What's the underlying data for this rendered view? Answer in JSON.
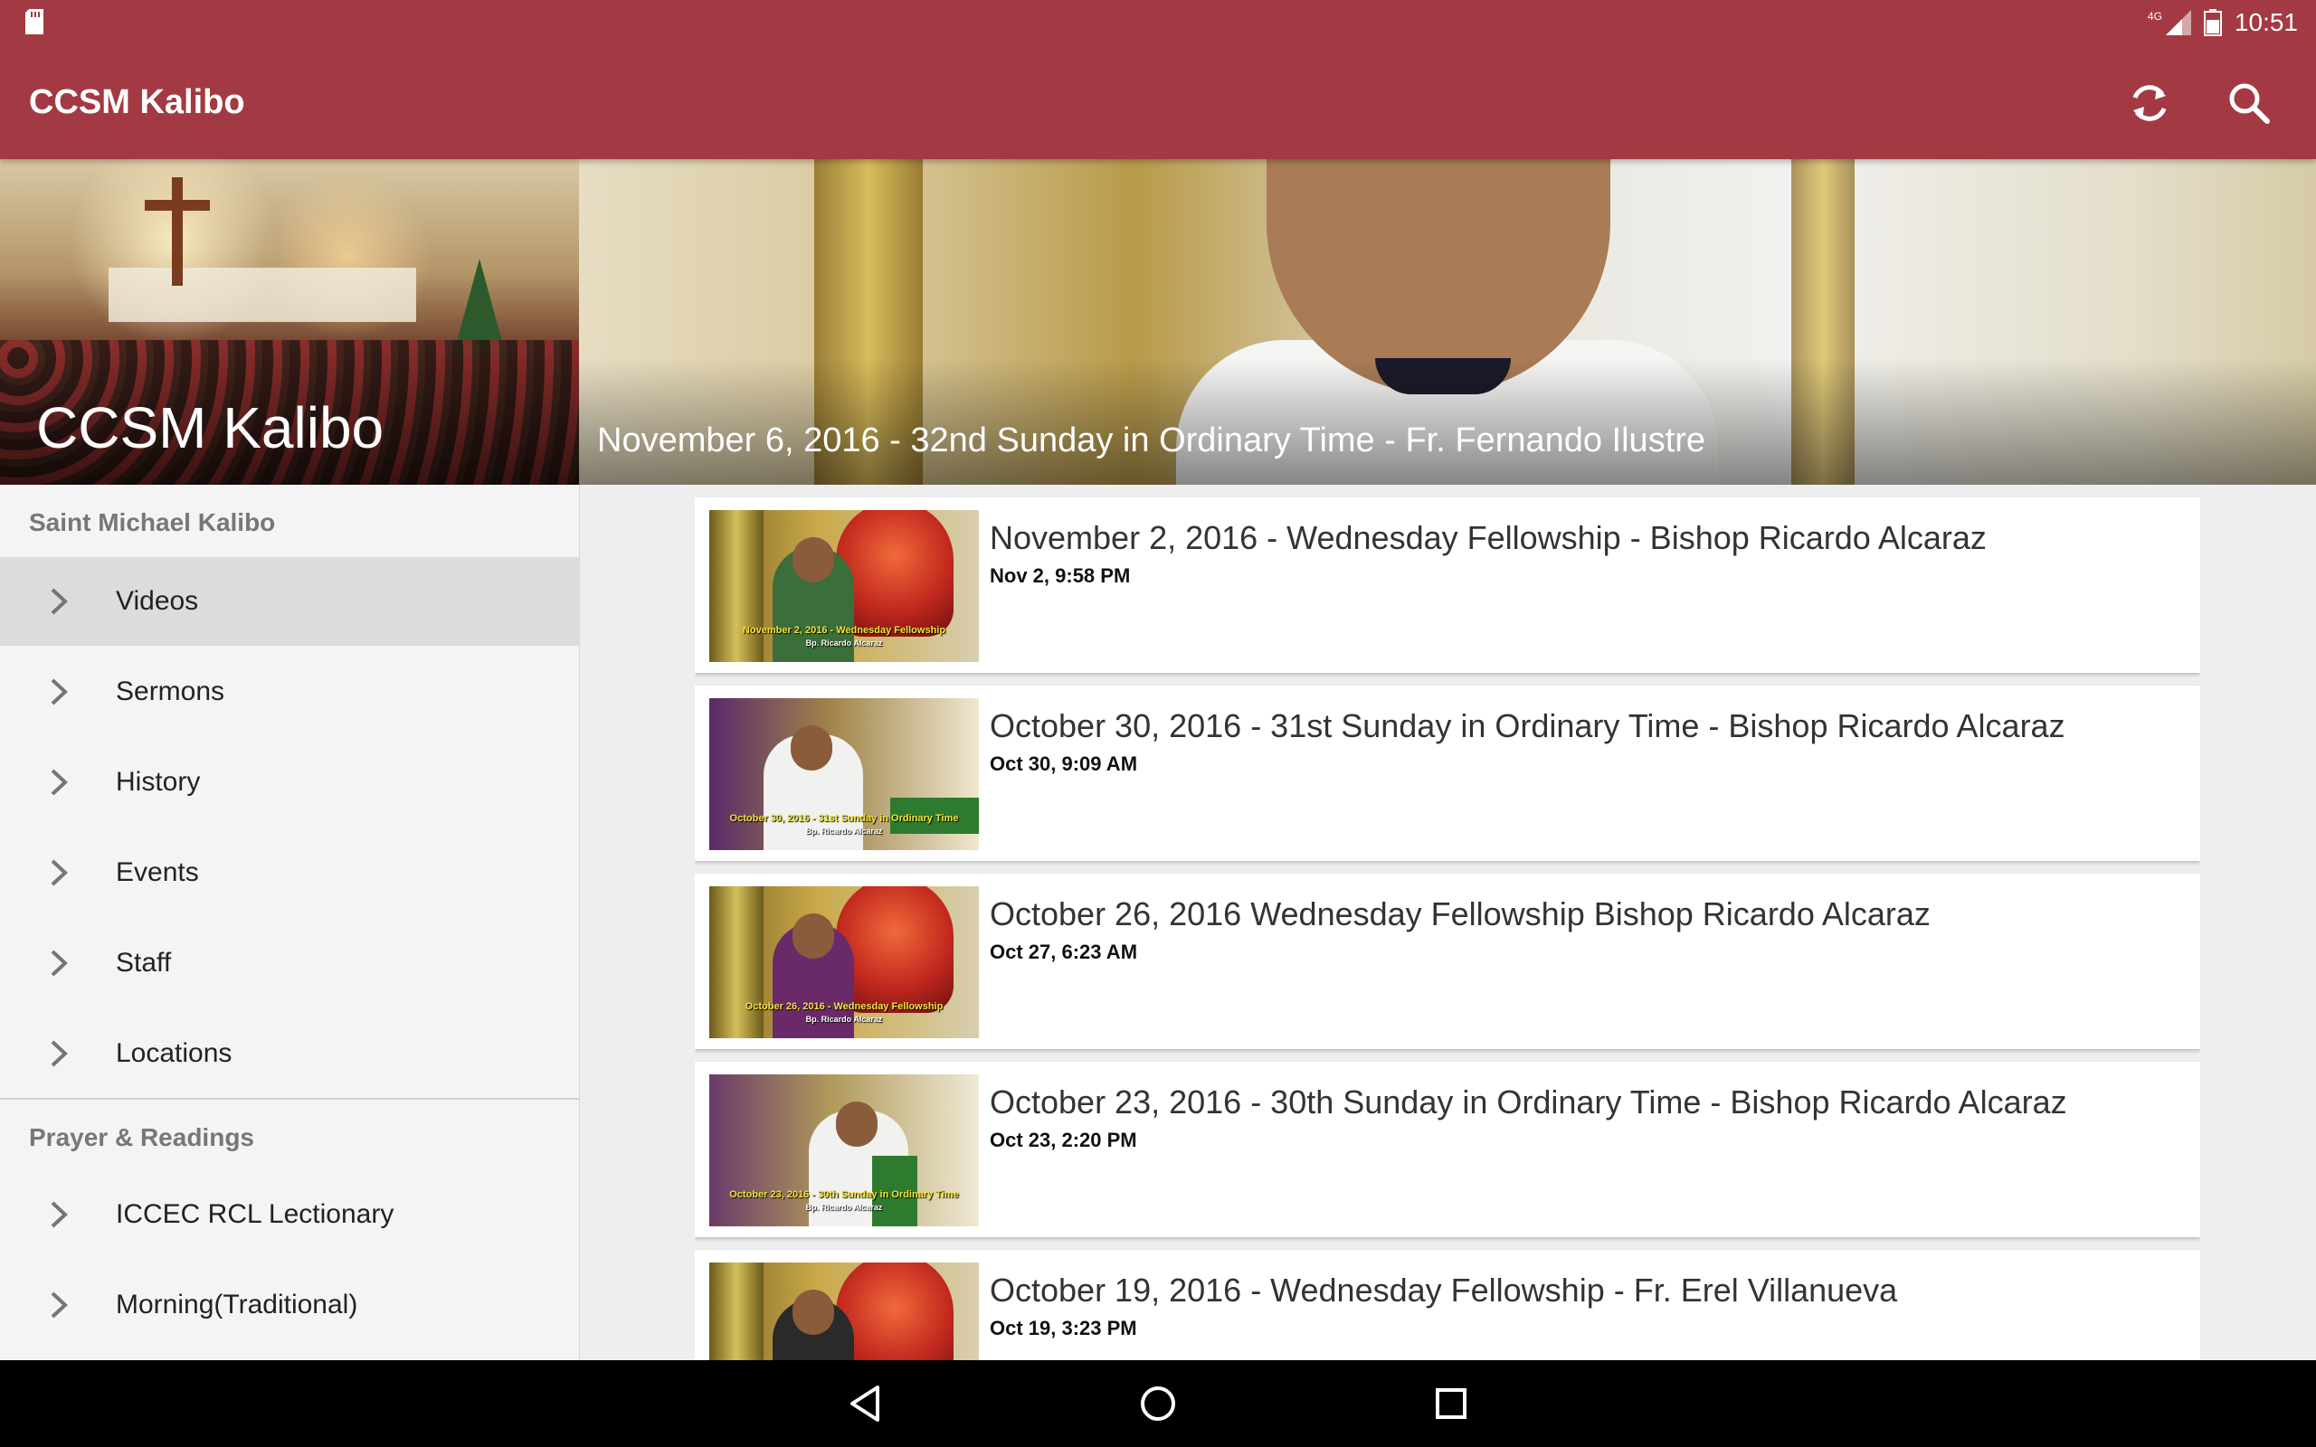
{
  "status_bar": {
    "time": "10:51",
    "network": "4G",
    "icons": [
      "sd-card-icon",
      "signal-icon",
      "battery-icon"
    ]
  },
  "app_bar": {
    "title": "CCSM Kalibo",
    "actions": [
      {
        "name": "refresh-button",
        "icon": "refresh-icon"
      },
      {
        "name": "search-button",
        "icon": "search-icon"
      }
    ],
    "color": "#a33a43"
  },
  "drawer": {
    "header_title": "CCSM Kalibo",
    "sections": [
      {
        "title": "Saint Michael Kalibo",
        "items": [
          "Videos",
          "Sermons",
          "History",
          "Events",
          "Staff",
          "Locations"
        ]
      },
      {
        "title": "Prayer & Readings",
        "items": [
          "ICCEC RCL Lectionary",
          "Morning(Traditional)"
        ]
      }
    ],
    "active_item": "Videos"
  },
  "featured": {
    "title": "November 6, 2016 - 32nd Sunday in Ordinary Time - Fr. Fernando Ilustre"
  },
  "videos": [
    {
      "title": "November 2, 2016 - Wednesday Fellowship - Bishop Ricardo Alcaraz",
      "date": "Nov 2, 9:58 PM",
      "thumb_caption": "November 2, 2016 - Wednesday Fellowship",
      "thumb_sub": "Bp. Ricardo Alcaraz"
    },
    {
      "title": "October 30, 2016 - 31st Sunday in Ordinary Time - Bishop Ricardo Alcaraz",
      "date": "Oct 30, 9:09 AM",
      "thumb_caption": "October 30, 2016 - 31st Sunday in Ordinary Time",
      "thumb_sub": "Bp. Ricardo Alcaraz"
    },
    {
      "title": "October 26, 2016   Wednesday Fellowship   Bishop Ricardo Alcaraz",
      "date": "Oct 27, 6:23 AM",
      "thumb_caption": "October 26, 2016 - Wednesday Fellowship",
      "thumb_sub": "Bp. Ricardo Alcaraz"
    },
    {
      "title": "October 23, 2016 - 30th Sunday in Ordinary Time - Bishop Ricardo Alcaraz",
      "date": "Oct 23, 2:20 PM",
      "thumb_caption": "October 23, 2016 - 30th Sunday in Ordinary Time",
      "thumb_sub": "Bp. Ricardo Alcaraz"
    },
    {
      "title": "October 19, 2016 - Wednesday Fellowship - Fr. Erel Villanueva",
      "date": "Oct 19, 3:23 PM",
      "thumb_caption": "",
      "thumb_sub": ""
    }
  ],
  "nav_bar": {
    "buttons": [
      "back-icon",
      "home-icon",
      "recents-icon"
    ]
  }
}
